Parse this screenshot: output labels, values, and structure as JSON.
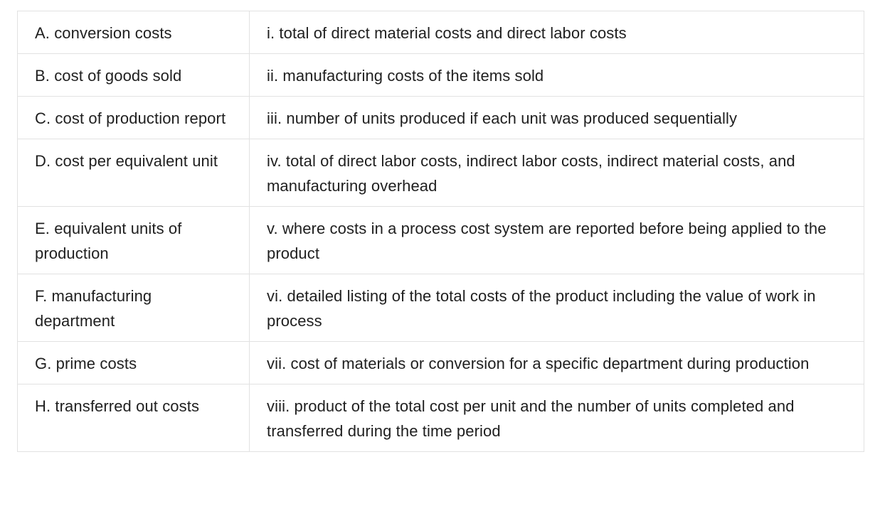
{
  "rows": [
    {
      "term": "A. conversion costs",
      "definition": "i. total of direct material costs and direct labor costs"
    },
    {
      "term": "B. cost of goods sold",
      "definition": "ii. manufacturing costs of the items sold"
    },
    {
      "term": "C. cost of production report",
      "definition": "iii. number of units produced if each unit was produced sequentially"
    },
    {
      "term": "D. cost per equivalent unit",
      "definition": "iv. total of direct labor costs, indirect labor costs, indirect material costs, and manufacturing overhead"
    },
    {
      "term": "E. equivalent units of production",
      "definition": "v. where costs in a process cost system are reported before being applied to the product"
    },
    {
      "term": "F. manufacturing department",
      "definition": "vi. detailed listing of the total costs of the product including the value of work in process"
    },
    {
      "term": "G. prime costs",
      "definition": "vii. cost of materials or conversion for a specific department during production"
    },
    {
      "term": "H. transferred out costs",
      "definition": "viii. product of the total cost per unit and the number of units completed and transferred during the time period"
    }
  ]
}
